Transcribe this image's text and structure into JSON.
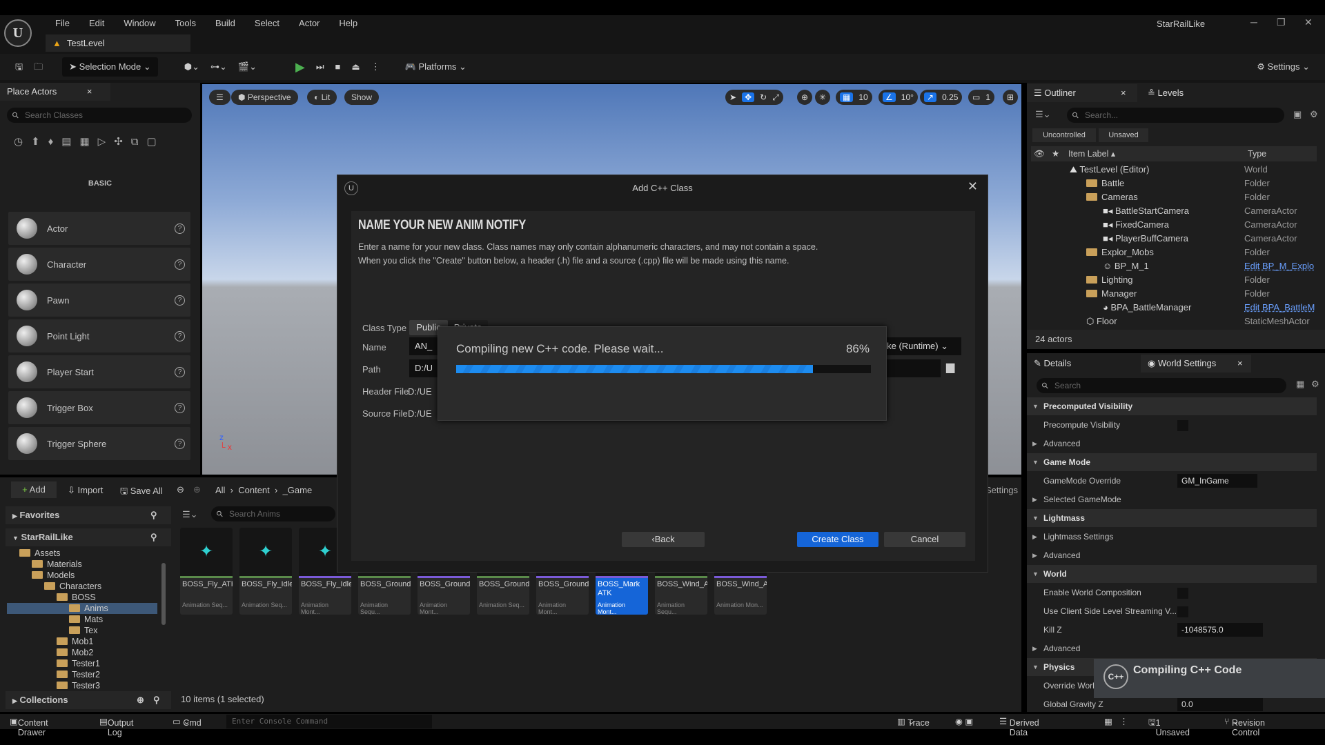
{
  "app": {
    "project": "StarRailLike",
    "menu": [
      "File",
      "Edit",
      "Window",
      "Tools",
      "Build",
      "Select",
      "Actor",
      "Help"
    ],
    "document_tab": "TestLevel"
  },
  "toolbar": {
    "selection_mode": "Selection Mode",
    "platforms": "Platforms",
    "settings": "Settings"
  },
  "place_actors": {
    "tab": "Place Actors",
    "search_placeholder": "Search Classes",
    "category": "BASIC",
    "items": [
      "Actor",
      "Character",
      "Pawn",
      "Point Light",
      "Player Start",
      "Trigger Box",
      "Trigger Sphere"
    ]
  },
  "viewport": {
    "perspective": "Perspective",
    "lit": "Lit",
    "show": "Show",
    "grid": "10",
    "angle": "10°",
    "scale": "0.25",
    "camera_speed": "1"
  },
  "dialog": {
    "title": "Add C++ Class",
    "heading": "NAME YOUR NEW ANIM NOTIFY",
    "desc1": "Enter a name for your new class. Class names may only contain alphanumeric characters, and may not contain a space.",
    "desc2": "When you click the \"Create\" button below, a header (.h) file and a source (.cpp) file will be made using this name.",
    "class_type_label": "Class Type",
    "public": "Public",
    "private": "Private",
    "name_label": "Name",
    "name_value": "AN_",
    "module": "Like (Runtime)",
    "path_label": "Path",
    "path_value": "D:/U",
    "header_label": "Header File",
    "header_value": "D:/UE",
    "source_label": "Source File",
    "source_value": "D:/UE",
    "back": "Back",
    "create": "Create Class",
    "cancel": "Cancel"
  },
  "compile": {
    "message": "Compiling new C++ code.  Please wait...",
    "percent_text": "86%",
    "progress": 0.86
  },
  "outliner": {
    "tab": "Outliner",
    "levels_tab": "Levels",
    "search_placeholder": "Search...",
    "filters": [
      "Uncontrolled",
      "Unsaved"
    ],
    "col_label": "Item Label",
    "col_type": "Type",
    "rows": [
      {
        "label": "TestLevel (Editor)",
        "type": "World",
        "indent": 0,
        "icon": "world"
      },
      {
        "label": "Battle",
        "type": "Folder",
        "indent": 1,
        "icon": "folder"
      },
      {
        "label": "Cameras",
        "type": "Folder",
        "indent": 1,
        "icon": "folder"
      },
      {
        "label": "BattleStartCamera",
        "type": "CameraActor",
        "indent": 2,
        "icon": "camera"
      },
      {
        "label": "FixedCamera",
        "type": "CameraActor",
        "indent": 2,
        "icon": "camera"
      },
      {
        "label": "PlayerBuffCamera",
        "type": "CameraActor",
        "indent": 2,
        "icon": "camera"
      },
      {
        "label": "Explor_Mobs",
        "type": "Folder",
        "indent": 1,
        "icon": "folder"
      },
      {
        "label": "BP_M_1",
        "type": "Edit BP_M_Explo",
        "indent": 2,
        "icon": "pawn",
        "link": true
      },
      {
        "label": "Lighting",
        "type": "Folder",
        "indent": 1,
        "icon": "folder"
      },
      {
        "label": "Manager",
        "type": "Folder",
        "indent": 1,
        "icon": "folder"
      },
      {
        "label": "BPA_BattleManager",
        "type": "Edit BPA_BattleM",
        "indent": 2,
        "icon": "actor",
        "link": true
      },
      {
        "label": "Floor",
        "type": "StaticMeshActor",
        "indent": 1,
        "icon": "mesh"
      }
    ],
    "count": "24 actors"
  },
  "details": {
    "tab": "Details",
    "world_settings_tab": "World Settings",
    "search_placeholder": "Search",
    "rows": [
      {
        "t": "Precomputed Visibility",
        "cat": true
      },
      {
        "t": "Precompute Visibility",
        "cb": true
      },
      {
        "t": "Advanced",
        "sub": true
      },
      {
        "t": "Game Mode",
        "cat": true
      },
      {
        "t": "GameMode Override",
        "val": "GM_InGame"
      },
      {
        "t": "Selected GameMode",
        "sub": true
      },
      {
        "t": "Lightmass",
        "cat": true
      },
      {
        "t": "Lightmass Settings",
        "sub": true
      },
      {
        "t": "Advanced",
        "sub": true
      },
      {
        "t": "World",
        "cat": true
      },
      {
        "t": "Enable World Composition",
        "cb": true
      },
      {
        "t": "Use Client Side Level Streaming V...",
        "cb": true
      },
      {
        "t": "Kill Z",
        "val": "-1048575.0"
      },
      {
        "t": "Advanced",
        "sub": true
      },
      {
        "t": "Physics",
        "cat": true
      },
      {
        "t": "Override World",
        "cb": false
      },
      {
        "t": "Global Gravity Z",
        "val": "0.0"
      }
    ]
  },
  "content": {
    "add": "Add",
    "import": "Import",
    "save_all": "Save All",
    "breadcrumb": [
      "All",
      "Content",
      "_Game"
    ],
    "settings": "Settings",
    "favorites": "Favorites",
    "project": "StarRailLike",
    "collections": "Collections",
    "search_placeholder": "Search Anims",
    "tree": [
      {
        "n": "Assets",
        "d": 1
      },
      {
        "n": "Materials",
        "d": 2
      },
      {
        "n": "Models",
        "d": 2
      },
      {
        "n": "Characters",
        "d": 3
      },
      {
        "n": "BOSS",
        "d": 4
      },
      {
        "n": "Anims",
        "d": 5,
        "sel": true
      },
      {
        "n": "Mats",
        "d": 5
      },
      {
        "n": "Tex",
        "d": 5
      },
      {
        "n": "Mob1",
        "d": 4
      },
      {
        "n": "Mob2",
        "d": 4
      },
      {
        "n": "Tester1",
        "d": 4
      },
      {
        "n": "Tester2",
        "d": 4
      },
      {
        "n": "Tester3",
        "d": 4
      }
    ],
    "assets": [
      {
        "n": "BOSS_Fly_ATK",
        "s": "Animation Seq...",
        "k": "seq"
      },
      {
        "n": "BOSS_Fly_Idle",
        "s": "Animation Seq...",
        "k": "seq"
      },
      {
        "n": "BOSS_Fly_Idle_Montage",
        "s": "Animation Mont...",
        "k": "mon"
      },
      {
        "n": "BOSS_Ground_ATK",
        "s": "Animation Sequ...",
        "k": "seq"
      },
      {
        "n": "BOSS_Ground_ATK_",
        "s": "Animation Mont...",
        "k": "mon"
      },
      {
        "n": "BOSS_Ground_Idle",
        "s": "Animation Seq...",
        "k": "seq"
      },
      {
        "n": "BOSS_Ground_Idle_Montage",
        "s": "Animation Mont...",
        "k": "mon"
      },
      {
        "n": "BOSS_Mark ATK",
        "s": "Animation Mont...",
        "k": "mon",
        "sel": true
      },
      {
        "n": "BOSS_Wind_Additive",
        "s": "Animation Sequ...",
        "k": "seq"
      },
      {
        "n": "BOSS_Wind_Additive_",
        "s": "Animation Mon...",
        "k": "mon"
      }
    ],
    "count": "10 items (1 selected)"
  },
  "statusbar": {
    "content_drawer": "Content Drawer",
    "output_log": "Output Log",
    "cmd": "Cmd",
    "console_placeholder": "Enter Console Command",
    "trace": "Trace",
    "derived_data": "Derived Data",
    "unsaved": "1 Unsaved",
    "revision_control": "Revision Control"
  },
  "toast": {
    "text": "Compiling C++ Code"
  },
  "colors": {
    "accent": "#1a73e8",
    "progress": "#1d8cf0",
    "folder": "#c9a05a",
    "anim_sequence": "#5a8a4a",
    "anim_montage": "#7a5ad8"
  }
}
